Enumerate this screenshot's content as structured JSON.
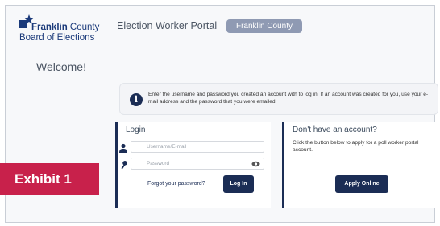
{
  "logo": {
    "name_bold": "Franklin",
    "name_rest": " County",
    "subtitle": "Board of Elections"
  },
  "header": {
    "title": "Election Worker Portal",
    "county_pill": "Franklin County"
  },
  "welcome": "Welcome!",
  "info": {
    "text": "Enter the username and password you created an account with to log in. If an account was created for you, use your e-mail address and the password that you were emailed."
  },
  "login": {
    "title": "Login",
    "username_placeholder": "Username/E-mail",
    "password_placeholder": "Password",
    "forgot_label": "Forgot your password?",
    "login_button": "Log In"
  },
  "signup": {
    "title": "Don't have an account?",
    "text": "Click the button below to apply for a poll worker portal account.",
    "apply_button": "Apply Online"
  },
  "exhibit_label": "Exhibit 1",
  "colors": {
    "navy": "#1b2d55",
    "pill": "#8f9ab3",
    "exhibit": "#c8214b"
  },
  "icons": {
    "info": "info-circle-icon",
    "user": "user-icon",
    "key": "key-icon",
    "eye": "eye-icon",
    "star": "star-icon"
  }
}
